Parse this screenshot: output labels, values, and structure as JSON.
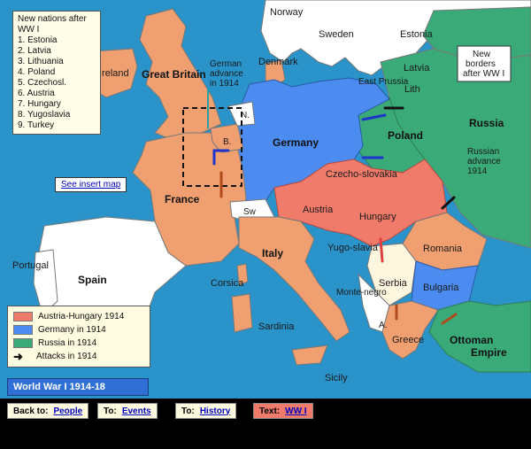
{
  "map": {
    "countries": {
      "norway": "Norway",
      "sweden": "Sweden",
      "denmark": "Denmark",
      "estonia": "Estonia",
      "latvia": "Latvia",
      "lithuania": "Lith",
      "east_prussia": "East Prussia",
      "ireland": "Ireland",
      "great_britain": "Great Britain",
      "germany": "Germany",
      "poland": "Poland",
      "russia": "Russia",
      "france": "France",
      "czechoslovakia": "Czecho-slovakia",
      "austria": "Austria",
      "hungary": "Hungary",
      "romania": "Romania",
      "yugoslavia": "Yugo-slavia",
      "serbia": "Serbia",
      "bulgaria": "Bulgaria",
      "montenegro": "Monte-negro",
      "italy": "Italy",
      "switzerland": "Sw",
      "belgium": "B.",
      "netherlands": "N.",
      "portugal": "Portugal",
      "spain": "Spain",
      "corsica": "Corsica",
      "sardinia": "Sardinia",
      "sicily": "Sicily",
      "greece": "Greece",
      "albania": "A.",
      "ottoman": "Ottoman Empire"
    },
    "annotations": {
      "german_advance": "German advance in 1914",
      "new_borders": "New borders after WW I",
      "russian_advance": "Russian advance 1914"
    },
    "colors": {
      "sea": "#2a93c9",
      "neutral": "#f0a070",
      "austria_hungary": "#f07b6b",
      "germany": "#4c8cf0",
      "russia": "#3aaa78",
      "other": "#ffffff"
    }
  },
  "new_nations": {
    "title": "New nations after WW I",
    "items": [
      "1. Estonia",
      "2. Latvia",
      "3. Lithuania",
      "4. Poland",
      "5. Czechosl.",
      "6. Austria",
      "7. Hungary",
      "8. Yugoslavia",
      "9. Turkey"
    ]
  },
  "insert_link": "See insert map",
  "legend": {
    "items": [
      {
        "label": "Austria-Hungary 1914",
        "color": "#f07b6b"
      },
      {
        "label": "Germany in 1914",
        "color": "#4c8cf0"
      },
      {
        "label": "Russia in 1914",
        "color": "#3aaa78"
      },
      {
        "label": "Attacks in 1914",
        "icon": "arrow-icon"
      }
    ]
  },
  "title": "World War I    1914-18",
  "nav": {
    "back": {
      "prefix": "Back to:",
      "link": "People"
    },
    "to_events": {
      "prefix": "To:",
      "link": "Events"
    },
    "to_history": {
      "prefix": "To:",
      "link": "History"
    },
    "text": {
      "prefix": "Text:",
      "link": "WW I"
    }
  }
}
